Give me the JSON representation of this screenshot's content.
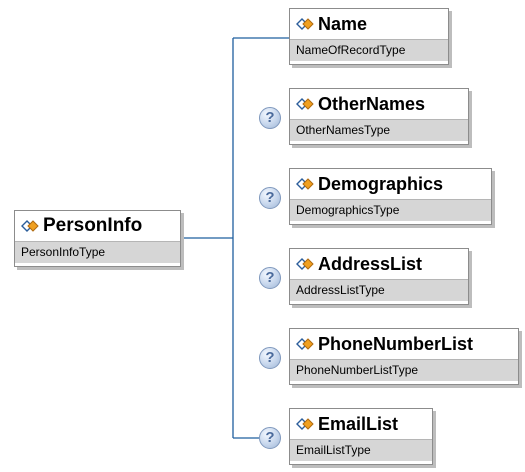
{
  "root": {
    "name": "PersonInfo",
    "type": "PersonInfoType",
    "icon": "element-icon"
  },
  "children": [
    {
      "name": "Name",
      "type": "NameOfRecordType",
      "optional": false
    },
    {
      "name": "OtherNames",
      "type": "OtherNamesType",
      "optional": true
    },
    {
      "name": "Demographics",
      "type": "DemographicsType",
      "optional": true
    },
    {
      "name": "AddressList",
      "type": "AddressListType",
      "optional": true
    },
    {
      "name": "PhoneNumberList",
      "type": "PhoneNumberListType",
      "optional": true
    },
    {
      "name": "EmailList",
      "type": "EmailListType",
      "optional": true
    }
  ],
  "optional_marker": "?",
  "colors": {
    "connector": "#1f5f9f",
    "type_band": "#d6d6d6",
    "border": "#8c8c8c"
  }
}
